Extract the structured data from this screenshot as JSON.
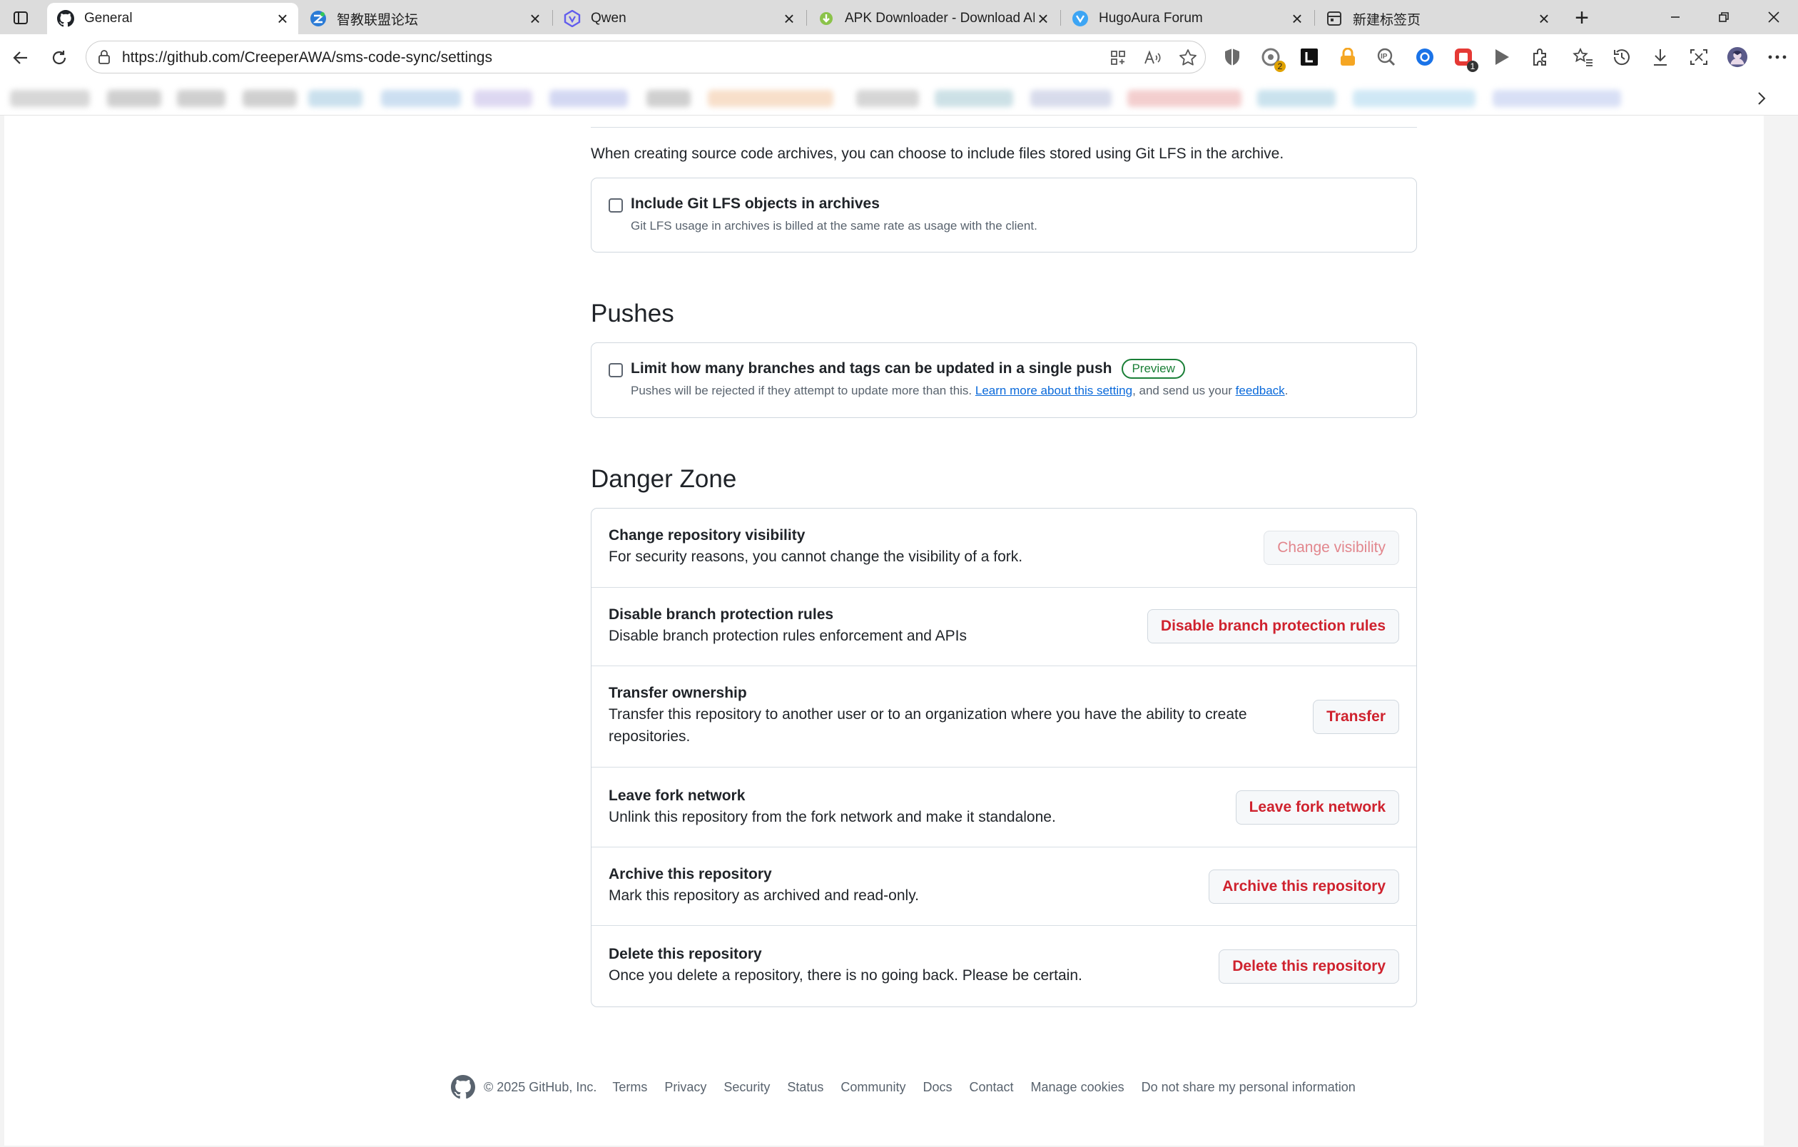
{
  "browser": {
    "tabs": [
      {
        "title": "General",
        "icon": "github-icon",
        "active": true
      },
      {
        "title": "智教联盟论坛",
        "icon": "forum-icon",
        "active": false
      },
      {
        "title": "Qwen",
        "icon": "qwen-icon",
        "active": false
      },
      {
        "title": "APK Downloader - Download APK",
        "icon": "android-icon",
        "active": false
      },
      {
        "title": "HugoAura Forum",
        "icon": "hugoaura-icon",
        "active": false
      },
      {
        "title": "新建标签页",
        "icon": "newtab-icon",
        "active": false
      }
    ],
    "close_glyph": "×",
    "new_tab_glyph": "+",
    "url": "https://github.com/CreeperAWA/sms-code-sync/settings",
    "extension_badges": {
      "copilot": "2",
      "adblock": "1"
    },
    "colors": {
      "accent_blue": "#0969da",
      "danger_red": "#cf222e",
      "success_green": "#1a7f37"
    }
  },
  "lfs": {
    "intro": "When creating source code archives, you can choose to include files stored using Git LFS in the archive.",
    "option_title": "Include Git LFS objects in archives",
    "option_desc": "Git LFS usage in archives is billed at the same rate as usage with the client."
  },
  "pushes": {
    "heading": "Pushes",
    "option_title": "Limit how many branches and tags can be updated in a single push",
    "preview_badge": "Preview",
    "desc_before": "Pushes will be rejected if they attempt to update more than this. ",
    "learn_link": "Learn more about this setting",
    "desc_middle": ", and send us your ",
    "feedback_link": "feedback",
    "desc_after": "."
  },
  "danger_zone": {
    "heading": "Danger Zone",
    "rows": [
      {
        "title": "Change repository visibility",
        "desc": "For security reasons, you cannot change the visibility of a fork.",
        "button": "Change visibility"
      },
      {
        "title": "Disable branch protection rules",
        "desc": "Disable branch protection rules enforcement and APIs",
        "button": "Disable branch protection rules"
      },
      {
        "title": "Transfer ownership",
        "desc": "Transfer this repository to another user or to an organization where you have the ability to create repositories.",
        "button": "Transfer"
      },
      {
        "title": "Leave fork network",
        "desc": "Unlink this repository from the fork network and make it standalone.",
        "button": "Leave fork network"
      },
      {
        "title": "Archive this repository",
        "desc": "Mark this repository as archived and read-only.",
        "button": "Archive this repository"
      },
      {
        "title": "Delete this repository",
        "desc": "Once you delete a repository, there is no going back. Please be certain.",
        "button": "Delete this repository"
      }
    ]
  },
  "footer": {
    "copyright": "© 2025 GitHub, Inc.",
    "links": [
      "Terms",
      "Privacy",
      "Security",
      "Status",
      "Community",
      "Docs",
      "Contact",
      "Manage cookies",
      "Do not share my personal information"
    ]
  }
}
